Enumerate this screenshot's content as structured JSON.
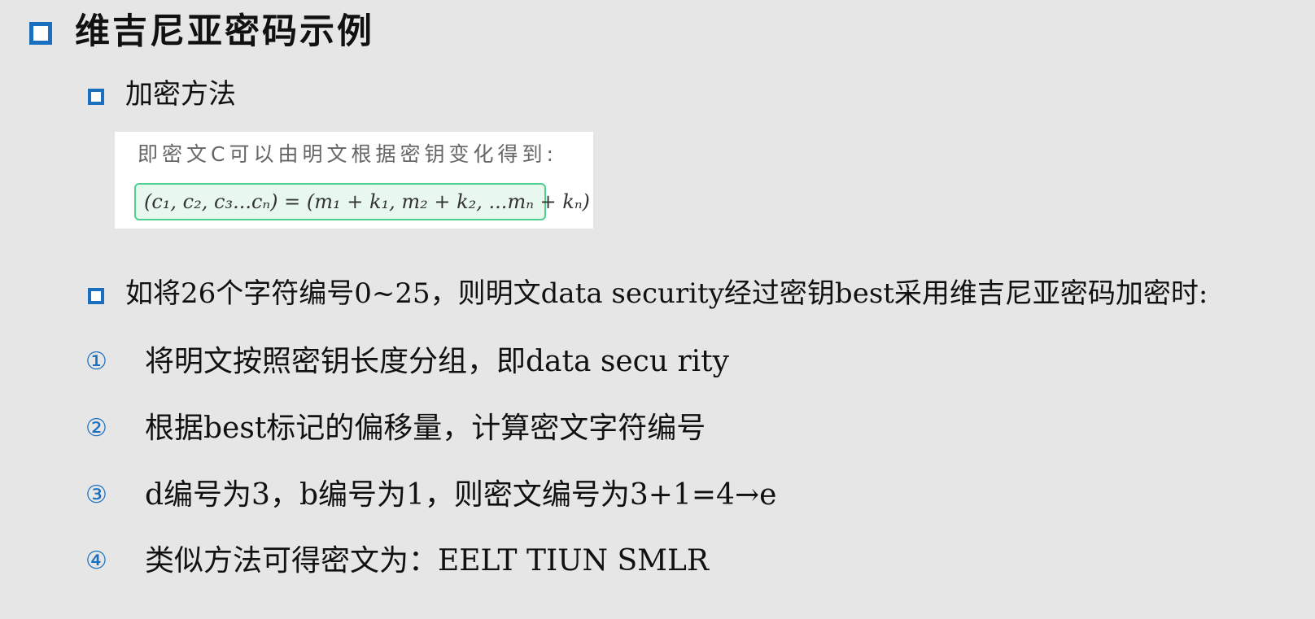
{
  "title": "维吉尼亚密码示例",
  "section1": {
    "heading": "加密方法"
  },
  "embed": {
    "caption": "即密文C可以由明文根据密钥变化得到:",
    "formula": "(c₁, c₂, c₃...cₙ) = (m₁ + k₁, m₂ + k₂, ...mₙ + kₙ)"
  },
  "section2": {
    "text": "如将26个字符编号0~25，则明文data security经过密钥best采用维吉尼亚密码加密时:"
  },
  "steps": [
    {
      "num": "①",
      "text": "将明文按照密钥长度分组，即data secu rity"
    },
    {
      "num": "②",
      "text": "根据best标记的偏移量，计算密文字符编号"
    },
    {
      "num": "③",
      "text": "d编号为3，b编号为1，则密文编号为3+1=4→e"
    },
    {
      "num": "④",
      "text": "类似方法可得密文为：EELT TIUN SMLR"
    }
  ],
  "colors": {
    "accent": "#1b6fbf",
    "background": "#e6e6e6",
    "formula_border": "#4fcf8f"
  }
}
